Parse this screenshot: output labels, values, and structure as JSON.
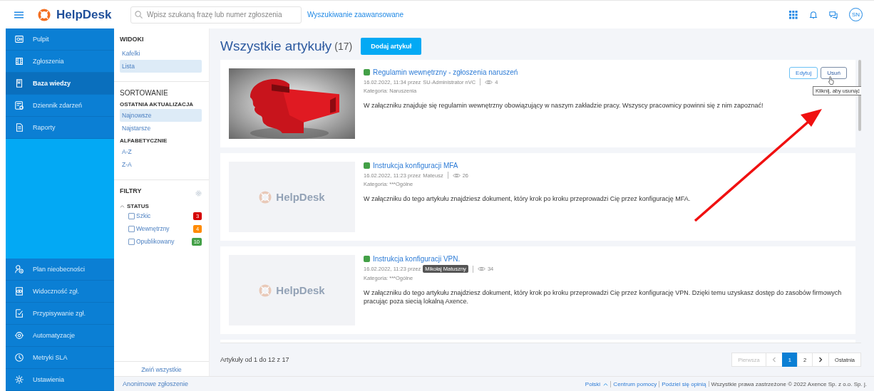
{
  "topbar": {
    "brand": "HelpDesk",
    "search": {
      "placeholder": "Wpisz szukaną frazę lub numer zgłoszenia"
    },
    "advanced_search": "Wyszukiwanie zaawansowane",
    "avatar": "SN"
  },
  "sidebar": {
    "top_items": [
      {
        "label": "Pulpit",
        "selected": false
      },
      {
        "label": "Zgłoszenia",
        "selected": false
      },
      {
        "label": "Baza wiedzy",
        "selected": true
      },
      {
        "label": "Dziennik zdarzeń",
        "selected": false
      },
      {
        "label": "Raporty",
        "selected": false
      }
    ],
    "bottom_items": [
      {
        "label": "Plan nieobecności",
        "selected": false
      },
      {
        "label": "Widoczność zgł.",
        "selected": false
      },
      {
        "label": "Przypisywanie zgł.",
        "selected": false
      },
      {
        "label": "Automatyzacje",
        "selected": false
      },
      {
        "label": "Metryki SLA",
        "selected": false
      },
      {
        "label": "Ustawienia",
        "selected": false
      }
    ]
  },
  "panel": {
    "views": {
      "title": "WIDOKI",
      "items": [
        {
          "label": "Kafelki",
          "selected": false
        },
        {
          "label": "Lista",
          "selected": true
        }
      ]
    },
    "sorting": {
      "title": "SORTOWANIE",
      "groups": [
        {
          "title": "OSTATNIA AKTUALIZACJA",
          "items": [
            {
              "label": "Najnowsze",
              "selected": true
            },
            {
              "label": "Najstarsze",
              "selected": false
            }
          ]
        },
        {
          "title": "ALFABETYCZNIE",
          "items": [
            {
              "label": "A-Z",
              "selected": false
            },
            {
              "label": "Z-A",
              "selected": false
            }
          ]
        }
      ]
    },
    "filters": {
      "title": "FILTRY",
      "groups": [
        {
          "title": "STATUS",
          "expanded": true,
          "items": [
            {
              "label": "Szkic",
              "checked": false,
              "count": "3",
              "color": "#d50000"
            },
            {
              "label": "Wewnętrzny",
              "checked": false,
              "count": "4",
              "color": "#ff8a00"
            },
            {
              "label": "Opublikowany",
              "checked": false,
              "count": "10",
              "color": "#43a047"
            }
          ]
        }
      ]
    },
    "collapse_all": "Zwiń wszystkie",
    "anonymous": "Anonimowe zgłoszenie"
  },
  "main": {
    "title": "Wszystkie artykuły",
    "count": "(17)",
    "add_button": "Dodaj artykuł",
    "articles": [
      {
        "image": {
          "kind": "picture"
        },
        "color": "#43a047",
        "title": "Regulamin wewnętrzny - zgłoszenia naruszeń",
        "date": "16.02.2022, 11:34 przez",
        "author": "SU-Administrator nVC",
        "author_highlighted": false,
        "views": "4",
        "category": "Kategoria: Naruszenia",
        "text": "W załączniku znajduje się regulamin wewnętrzny obowiązujący w naszym zakładzie pracy. Wszyscy pracownicy powinni się z nim zapoznać!",
        "actions": [
          "Edytuj",
          "Usuń"
        ],
        "tooltip": "Kliknij, aby usunąć"
      },
      {
        "image": {
          "kind": "logo",
          "text": "HelpDesk"
        },
        "color": "#43a047",
        "title": "Instrukcja konfiguracji MFA",
        "date": "16.02.2022, 11:23 przez",
        "author": "Mateusz",
        "author_highlighted": false,
        "views": "26",
        "category": "Kategoria: ***Ogólne",
        "text": "W załączniku do tego artykułu znajdziesz dokument, który krok po kroku przeprowadzi Cię przez konfigurację MFA."
      },
      {
        "image": {
          "kind": "logo",
          "text": "HelpDesk"
        },
        "color": "#43a047",
        "title": "Instrukcja konfiguracji VPN.",
        "date": "16.02.2022, 11:23 przez",
        "author": "Mikołaj Matuszny",
        "author_highlighted": true,
        "views": "34",
        "category": "Kategoria: ***Ogólne",
        "text": "W załączniku do tego artykułu znajdziesz dokument, który krok po kroku przeprowadzi Cię przez konfigurację VPN. Dzięki temu uzyskasz dostęp do zasobów firmowych pracując poza siecią lokalną Axence."
      }
    ],
    "range": "Artykuły od 1 do 12 z 17",
    "pagination": [
      {
        "kind": "text",
        "label": "Pierwsza",
        "disabled": true,
        "selected": false
      },
      {
        "kind": "prev",
        "disabled": true,
        "selected": false
      },
      {
        "kind": "page",
        "label": "1",
        "disabled": false,
        "selected": true
      },
      {
        "kind": "page",
        "label": "2",
        "disabled": false,
        "selected": false
      },
      {
        "kind": "next",
        "disabled": false,
        "selected": false
      },
      {
        "kind": "text",
        "label": "Ostatnia",
        "disabled": false,
        "selected": false
      }
    ]
  },
  "footer": {
    "language": "Polski",
    "links": [
      "Centrum pomocy",
      "Podziel się opinią"
    ],
    "copyright": "Wszystkie prawa zastrzeżone © 2022 Axence Sp. z o.o. Sp. j."
  }
}
